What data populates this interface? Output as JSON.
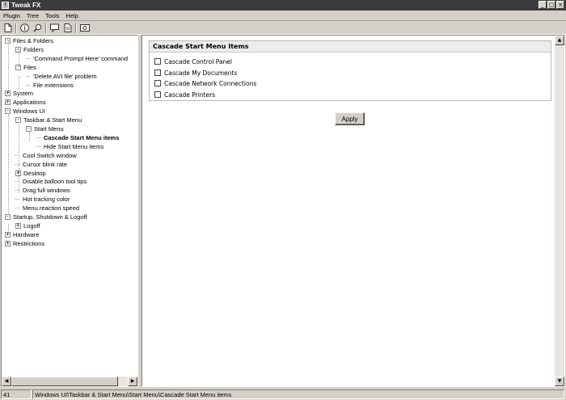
{
  "window": {
    "title": "Tweak FX",
    "app_icon": "T",
    "buttons": {
      "minimize": "_",
      "maximize": "□",
      "close": "×"
    }
  },
  "menu": [
    "Plugin",
    "Tree",
    "Tools",
    "Help"
  ],
  "toolbar": {
    "icons": [
      "new-page-icon",
      "info-icon",
      "search-icon",
      "comment-icon",
      "document-icon",
      "image-icon"
    ]
  },
  "tree": [
    {
      "label": "Files & Folders",
      "expander": "-"
    },
    {
      "label": "Folders",
      "expander": "-"
    },
    {
      "label": "'Command Prompt Here' command",
      "expander": ""
    },
    {
      "label": "Files",
      "expander": "-"
    },
    {
      "label": "'Delete AVI file' problem",
      "expander": ""
    },
    {
      "label": "File extensions",
      "expander": ""
    },
    {
      "label": "System",
      "expander": "+"
    },
    {
      "label": "Applications",
      "expander": "+"
    },
    {
      "label": "Windows UI",
      "expander": "-"
    },
    {
      "label": "Taskbar & Start Menu",
      "expander": "-"
    },
    {
      "label": "Start Menu",
      "expander": "-"
    },
    {
      "label": "Cascade Start Menu items",
      "expander": ""
    },
    {
      "label": "Hide Start Menu items",
      "expander": ""
    },
    {
      "label": "Cool Switch window",
      "expander": ""
    },
    {
      "label": "Cursor blink rate",
      "expander": ""
    },
    {
      "label": "Desktop",
      "expander": "+"
    },
    {
      "label": "Disable balloon tool tips",
      "expander": ""
    },
    {
      "label": "Drag full windows",
      "expander": ""
    },
    {
      "label": "Hot tracking color",
      "expander": ""
    },
    {
      "label": "Menu reaction speed",
      "expander": ""
    },
    {
      "label": "Startup, Shutdown & Logoff",
      "expander": "-"
    },
    {
      "label": "Logoff",
      "expander": "+"
    },
    {
      "label": "Hardware",
      "expander": "+"
    },
    {
      "label": "Restrictions",
      "expander": "+"
    }
  ],
  "tree_selected_index": 11,
  "content": {
    "group_title": "Cascade Start Menu Items",
    "options": [
      {
        "label": "Cascade Control Panel",
        "checked": false
      },
      {
        "label": "Cascade My Documents",
        "checked": false
      },
      {
        "label": "Cascade Network Connections",
        "checked": false
      },
      {
        "label": "Cascade Printers",
        "checked": false
      }
    ],
    "apply_label": "Apply"
  },
  "status": {
    "count": "41",
    "path": "Windows UI\\Taskbar & Start Menu\\Start Menu\\Cascade Start Menu items"
  }
}
